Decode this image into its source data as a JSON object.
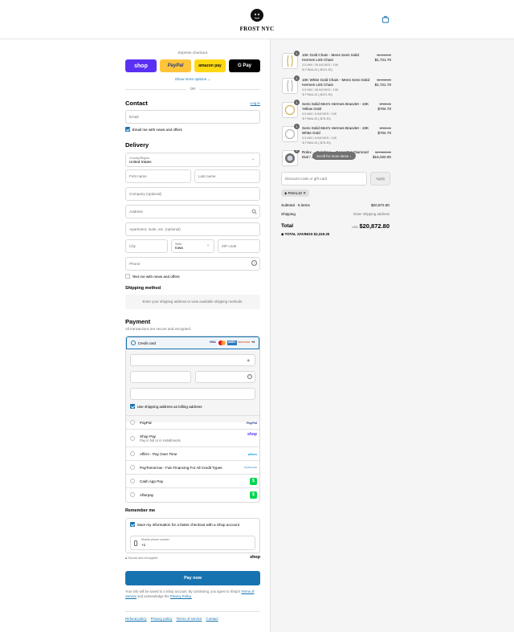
{
  "brand": {
    "name": "FROST NYC"
  },
  "express": {
    "title": "Express checkout",
    "buttons": [
      {
        "label": "shop",
        "color": "#5a31f4"
      },
      {
        "label": "PayPal",
        "color": "#ffc439"
      },
      {
        "label": "amazon pay",
        "color": "#ffd814"
      },
      {
        "label": "G Pay",
        "color": "#000000"
      }
    ],
    "show_more": "Show more options",
    "or": "OR"
  },
  "contact": {
    "title": "Contact",
    "login": "Log in",
    "email_placeholder": "Email",
    "email_news": "Email me with news and offers"
  },
  "delivery": {
    "title": "Delivery",
    "country_label": "Country/Region",
    "country_value": "United States",
    "first_name": "First name",
    "last_name": "Last name",
    "company": "Company (optional)",
    "address": "Address",
    "apartment": "Apartment, suite, etc. (optional)",
    "city": "City",
    "state_label": "State",
    "state_value": "Iowa",
    "zip": "ZIP code",
    "phone": "Phone",
    "text_news": "Text me with news and offers"
  },
  "shipping": {
    "title": "Shipping method",
    "message": "Enter your shipping address to view available shipping methods."
  },
  "payment": {
    "title": "Payment",
    "subtitle": "All transactions are secure and encrypted.",
    "credit_card": "Credit card",
    "card_brands": [
      "VISA",
      "MC",
      "AMEX",
      "DISCOVER",
      "+4"
    ],
    "billing_same": "Use shipping address as billing address",
    "methods": [
      {
        "label": "PayPal",
        "sub": "",
        "logo": "PayPal"
      },
      {
        "label": "Shop Pay",
        "sub": "Pay in full or in installments",
        "logo": "shop"
      },
      {
        "label": "Affirm - Pay Over Time",
        "sub": "",
        "logo": "affirm"
      },
      {
        "label": "PayTomorrow - Fair Financing For All Credit Types",
        "sub": "",
        "logo": "PayTomorrow"
      },
      {
        "label": "Cash App Pay",
        "sub": "",
        "logo": "$"
      },
      {
        "label": "Afterpay",
        "sub": "",
        "logo": "$"
      }
    ]
  },
  "remember": {
    "title": "Remember me",
    "save_info": "Save my information for a faster checkout with a Shop account",
    "mobile_label": "Mobile phone number",
    "mobile_value": "+1",
    "secure": "Secure and encrypted",
    "shop": "shop"
  },
  "pay_now": "Pay now",
  "legal": {
    "text1": "Your info will be saved to a Shop account. By continuing, you agree to Shop's",
    "terms": "Terms of Service",
    "text2": "and acknowledge the",
    "privacy": "Privacy Policy."
  },
  "footer_links": [
    "Refund policy",
    "Privacy policy",
    "Terms of service",
    "Contact"
  ],
  "order": {
    "items": [
      {
        "qty": "1",
        "name": "10K Gold Chain - Mens Semi Solid Hermes Link Chain",
        "variant": "3.5 MM / 26 INCHES / 10K",
        "discount": "FINAL10 (-$191.30)",
        "old": "$1,913.00",
        "new": "$1,721.70"
      },
      {
        "qty": "1",
        "name": "10K White Gold Chain - Mens Semi Solid Hermes Link Chain",
        "variant": "3.5 MM / 26 INCHES / 10K",
        "discount": "FINAL10 (-$191.30)",
        "old": "$1,913.00",
        "new": "$1,721.70"
      },
      {
        "qty": "1",
        "name": "Semi Solid Men's Hermes Bracelet - 10K Yellow Gold",
        "variant": "3.5 MM / 8 INCHES / 10K",
        "discount": "FINAL10 (-$78.30)",
        "old": "$783.00",
        "new": "$704.70"
      },
      {
        "qty": "1",
        "name": "Semi Solid Men's Hermes Bracelet - 10K White Gold",
        "variant": "3.5 MM / 8 INCHES / 10K",
        "discount": "FINAL10 (-$78.30)",
        "old": "$783.00",
        "new": "$704.70"
      },
      {
        "qty": "1",
        "name": "Rolex ... Rainbow ... Baguettes Diamond Dial / Jubilee Band",
        "variant": "",
        "discount": "",
        "old": "$17,800.00",
        "new": "$16,020.00"
      }
    ],
    "scroll_hint": "Scroll for more items",
    "discount_placeholder": "Discount code or gift card",
    "apply": "Apply",
    "applied_code": "FINAL10",
    "subtotal_label": "Subtotal · 5 items",
    "subtotal_value": "$20,872.80",
    "shipping_label": "Shipping",
    "shipping_value": "Enter shipping address",
    "total_label": "Total",
    "currency": "USD",
    "total_value": "$20,872.80",
    "savings_label": "TOTAL SAVINGS",
    "savings_value": "$2,319.20"
  },
  "colors": {
    "accent": "#1773b0",
    "pay_button": "#1773b0",
    "cash_app": "#00d64f"
  }
}
